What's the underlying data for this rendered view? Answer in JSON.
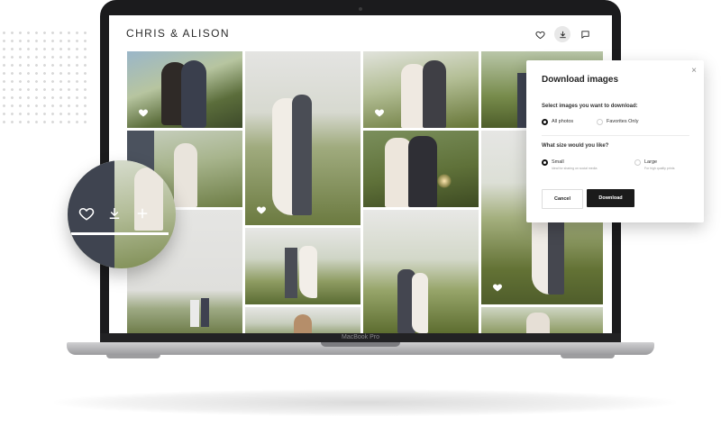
{
  "brand": {
    "name": "CHRIS & ALISON"
  },
  "header": {
    "icons": [
      "heart-icon",
      "download-icon",
      "comment-icon"
    ]
  },
  "laptop": {
    "model": "MacBook Pro"
  },
  "download_modal": {
    "title": "Download images",
    "close": "×",
    "select_question": "Select images you want to download:",
    "select_options": [
      {
        "label": "All photos",
        "selected": true
      },
      {
        "label": "Favorites Only",
        "selected": false
      }
    ],
    "size_question": "What size would you like?",
    "size_options": [
      {
        "label": "Small",
        "description": "Ideal for sharing on social media",
        "selected": true
      },
      {
        "label": "Large",
        "description": "For high quality prints",
        "selected": false
      }
    ],
    "cancel_label": "Cancel",
    "download_label": "Download"
  },
  "zoom_overlay": {
    "icons": [
      "heart-icon",
      "download-icon",
      "plus-icon"
    ]
  },
  "colors": {
    "laptop_body": "#1b1b1d",
    "button_dark": "#1b1b1b",
    "background": "#ffffff"
  }
}
